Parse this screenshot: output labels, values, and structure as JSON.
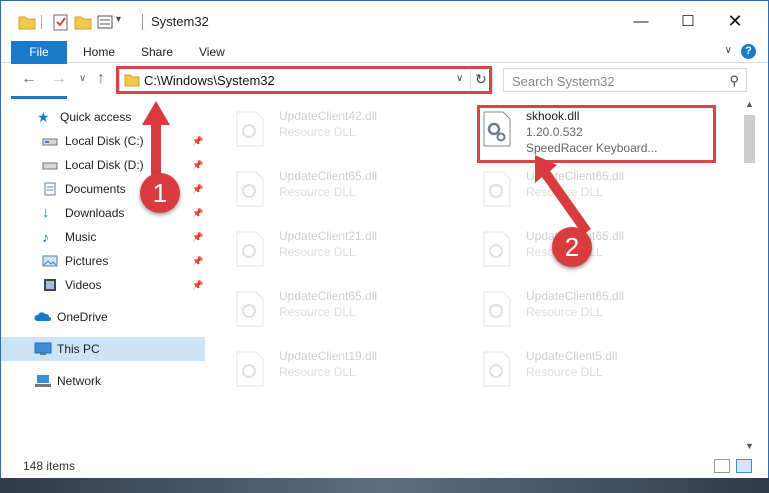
{
  "window": {
    "title": "System32"
  },
  "ribbon": {
    "tabs": [
      "File",
      "Home",
      "Share",
      "View"
    ],
    "help": "?"
  },
  "nav": {
    "address": "C:\\Windows\\System32",
    "search_placeholder": "Search System32"
  },
  "sidebar": {
    "items": [
      {
        "label": "Quick access",
        "icon": "star-icon",
        "pinned": false
      },
      {
        "label": "Local Disk (C:)",
        "icon": "drive-icon",
        "pinned": true
      },
      {
        "label": "Local Disk (D:)",
        "icon": "drive-icon",
        "pinned": true
      },
      {
        "label": "Documents",
        "icon": "documents-icon",
        "pinned": true
      },
      {
        "label": "Downloads",
        "icon": "downloads-icon",
        "pinned": true
      },
      {
        "label": "Music",
        "icon": "music-icon",
        "pinned": true
      },
      {
        "label": "Pictures",
        "icon": "pictures-icon",
        "pinned": true
      },
      {
        "label": "Videos",
        "icon": "videos-icon",
        "pinned": true
      },
      {
        "label": "OneDrive",
        "icon": "cloud-icon",
        "pinned": false
      },
      {
        "label": "This PC",
        "icon": "computer-icon",
        "pinned": false,
        "selected": true
      },
      {
        "label": "Network",
        "icon": "network-icon",
        "pinned": false
      }
    ]
  },
  "files": {
    "highlighted": {
      "name": "skhook.dll",
      "version": "1.20.0.532",
      "description": "SpeedRacer Keyboard..."
    },
    "left_column": [
      {
        "name": "UpdateClient42.dll",
        "type": "Resource DLL"
      },
      {
        "name": "UpdateClient65.dll",
        "type": "Resource DLL"
      },
      {
        "name": "UpdateClient21.dll",
        "type": "Resource DLL"
      },
      {
        "name": "UpdateClient65.dll",
        "type": "Resource DLL"
      },
      {
        "name": "UpdateClient19.dll",
        "type": "Resource DLL"
      }
    ],
    "right_column": [
      {
        "name": "UpdateClient65.dll",
        "type": "Resource DLL"
      },
      {
        "name": "UpdateClient65.dll",
        "type": "Resource DLL"
      },
      {
        "name": "UpdateClient65.dll",
        "type": "Resource DLL"
      },
      {
        "name": "UpdateClient5.dll",
        "type": "Resource DLL"
      }
    ]
  },
  "status": {
    "item_count": "148 items"
  },
  "annotations": {
    "step1": "1",
    "step2": "2"
  },
  "colors": {
    "accent": "#1979ca",
    "highlight": "#d6454a",
    "selection": "#cce4f7"
  }
}
